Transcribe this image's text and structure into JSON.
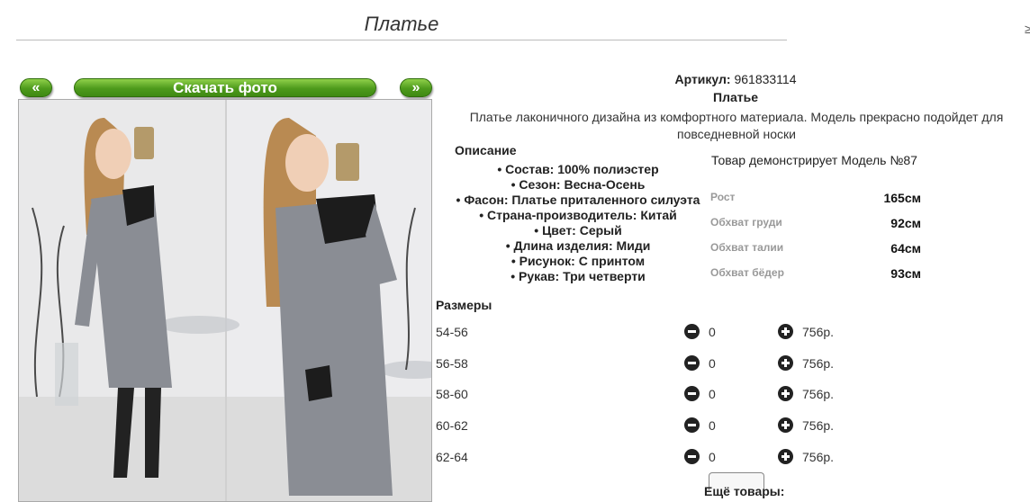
{
  "page": {
    "title": "Платье",
    "edge_mark": "≥"
  },
  "gallery": {
    "prev_label": "«",
    "next_label": "»",
    "download_label": "Скачать фото"
  },
  "product": {
    "article_label": "Артикул:",
    "article_value": "961833114",
    "name": "Платье",
    "description": "Платье лаконичного дизайна из комфортного материала. Модель прекрасно подойдет для повседневной носки",
    "description_heading": "Описание",
    "properties": [
      "Состав: 100% полиэстер",
      "Сезон: Весна-Осень",
      "Фасон: Платье приталенного силуэта",
      "Страна-производитель: Китай",
      "Цвет: Серый",
      "Длина изделия: Миди",
      "Рисунок: С принтом",
      "Рукав: Три четверти"
    ]
  },
  "model": {
    "caption": "Товар демонстрирует Модель №87",
    "measurements": [
      {
        "label": "Рост",
        "value": "165см"
      },
      {
        "label": "Обхват груди",
        "value": "92см"
      },
      {
        "label": "Обхват талии",
        "value": "64см"
      },
      {
        "label": "Обхват бёдер",
        "value": "93см"
      }
    ]
  },
  "sizes": {
    "heading": "Размеры",
    "rows": [
      {
        "size": "54-56",
        "qty": "0",
        "price": "756р."
      },
      {
        "size": "56-58",
        "qty": "0",
        "price": "756р."
      },
      {
        "size": "58-60",
        "qty": "0",
        "price": "756р."
      },
      {
        "size": "60-62",
        "qty": "0",
        "price": "756р."
      },
      {
        "size": "62-64",
        "qty": "0",
        "price": "756р."
      }
    ]
  },
  "footer": {
    "more_goods": "Ещё товары:"
  },
  "colors": {
    "button_green": "#4d9a1c",
    "dress_grey": "#8a8d94",
    "sleeve_black": "#1c1c1c",
    "hair": "#b98a52"
  }
}
